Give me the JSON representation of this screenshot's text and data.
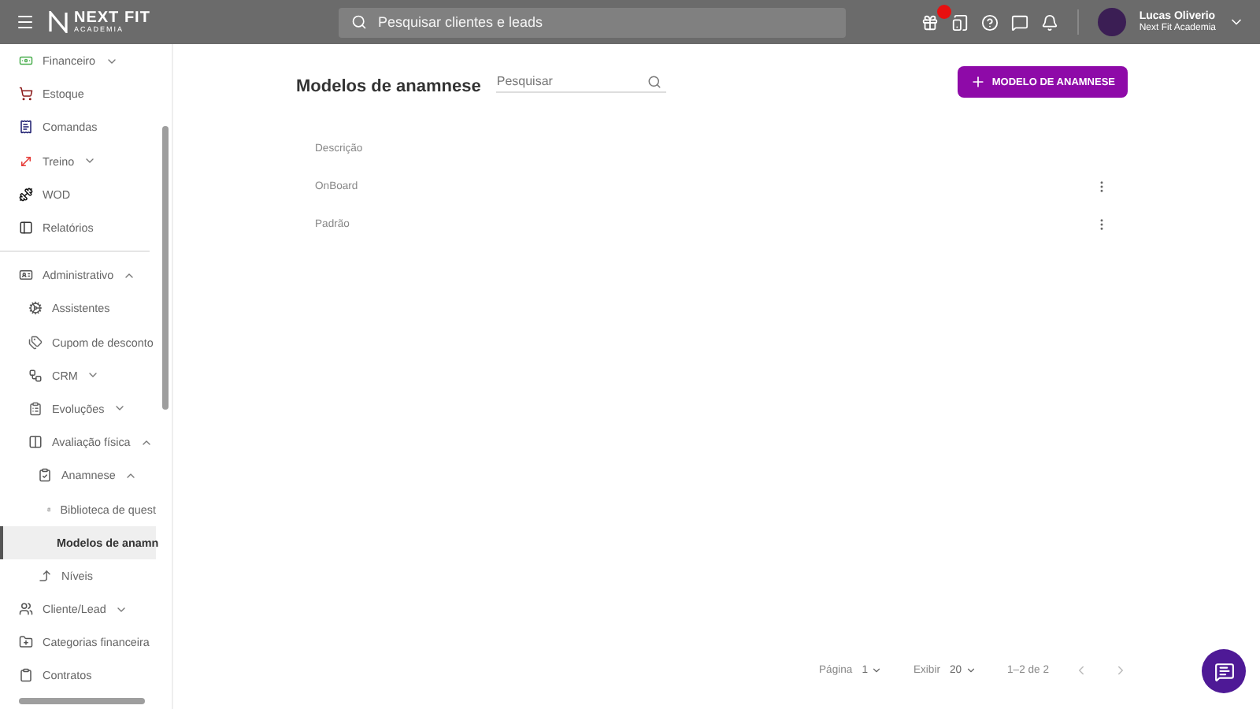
{
  "header": {
    "brand": "NEXT FIT",
    "brand_sub": "ACADEMIA",
    "search": {
      "placeholder": "Pesquisar clientes e leads"
    },
    "gift_badge": true,
    "user": {
      "name": "Lucas Oliverio",
      "org": "Next Fit Academia"
    }
  },
  "sidebar": {
    "items": [
      {
        "label": "Financeiro",
        "expanded": false,
        "selected": false
      },
      {
        "label": "Estoque",
        "selected": false
      },
      {
        "label": "Comandas",
        "selected": false
      },
      {
        "label": "Treino",
        "expanded": false,
        "selected": false
      },
      {
        "label": "WOD",
        "selected": false
      },
      {
        "label": "Relatórios",
        "selected": false
      },
      {
        "label": "Administrativo",
        "expanded": true,
        "selected": false,
        "children": [
          {
            "label": "Assistentes",
            "selected": false
          },
          {
            "label": "Cupom de desconto",
            "selected": false
          },
          {
            "label": "CRM",
            "expanded": false,
            "selected": false
          },
          {
            "label": "Evoluções",
            "expanded": false,
            "selected": false
          },
          {
            "label": "Avaliação física",
            "expanded": true,
            "selected": false,
            "children": [
              {
                "label": "Anamnese",
                "expanded": true,
                "selected": false,
                "children": [
                  {
                    "label": "Biblioteca de quest",
                    "selected": false
                  },
                  {
                    "label": "Modelos de anamn",
                    "selected": true
                  }
                ]
              },
              {
                "label": "Níveis",
                "selected": false
              }
            ]
          }
        ]
      },
      {
        "label": "Cliente/Lead",
        "expanded": false,
        "selected": false
      },
      {
        "label": "Categorias financeira",
        "selected": false
      },
      {
        "label": "Contratos",
        "selected": false
      }
    ]
  },
  "page": {
    "title": "Modelos de anamnese",
    "search": {
      "placeholder": "Pesquisar"
    },
    "add_button": "MODELO DE ANAMNESE"
  },
  "table": {
    "columns": [
      "Descrição"
    ],
    "rows": [
      {
        "cells": [
          "OnBoard"
        ]
      },
      {
        "cells": [
          "Padrão"
        ]
      }
    ]
  },
  "pagination": {
    "page_label": "Página",
    "page": "1",
    "show_label": "Exibir",
    "per_page": "20",
    "range": "1–2 de 2"
  }
}
